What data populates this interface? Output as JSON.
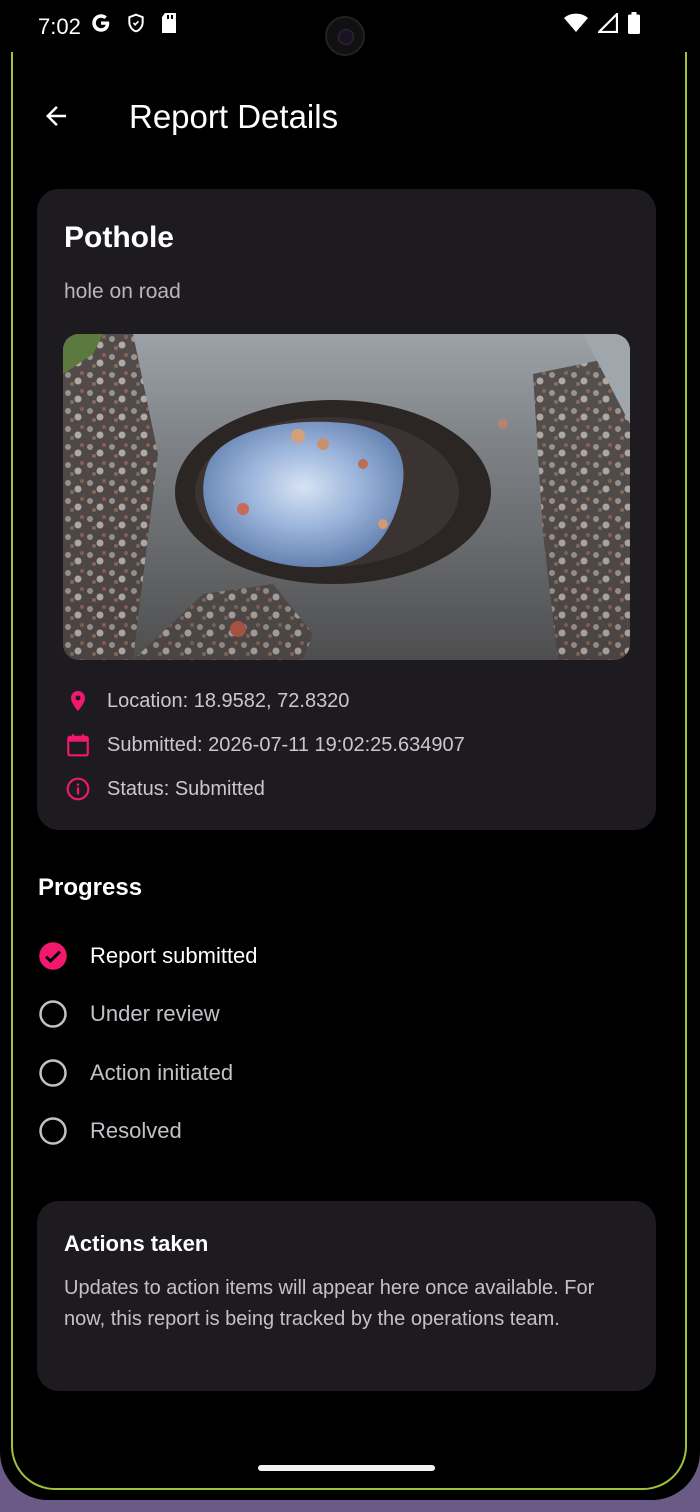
{
  "status_bar": {
    "time": "7:02",
    "icons_left": [
      "google-g-icon",
      "shield-icon",
      "sd-card-icon"
    ],
    "icons_right": [
      "wifi-icon",
      "signal-icon",
      "battery-icon"
    ]
  },
  "app_bar": {
    "title": "Report Details",
    "back_icon": "arrow-back-icon"
  },
  "report": {
    "title": "Pothole",
    "description": "hole on road",
    "photo_alt": "pothole-photo",
    "location": "Location: 18.9582, 72.8320",
    "submitted": "Submitted: 2026-07-11 19:02:25.634907",
    "status": "Status: Submitted"
  },
  "progress": {
    "title": "Progress",
    "steps": [
      {
        "label": "Report submitted",
        "done": true
      },
      {
        "label": "Under review",
        "done": false
      },
      {
        "label": "Action initiated",
        "done": false
      },
      {
        "label": "Resolved",
        "done": false
      }
    ]
  },
  "actions": {
    "title": "Actions taken",
    "body": "Updates to action items will appear here once available. For now, this report is being tracked by the operations team."
  },
  "colors": {
    "accent": "#f0196e",
    "card_bg": "#1d1b20",
    "background": "#000000",
    "frame_accent": "#9fc23a"
  }
}
